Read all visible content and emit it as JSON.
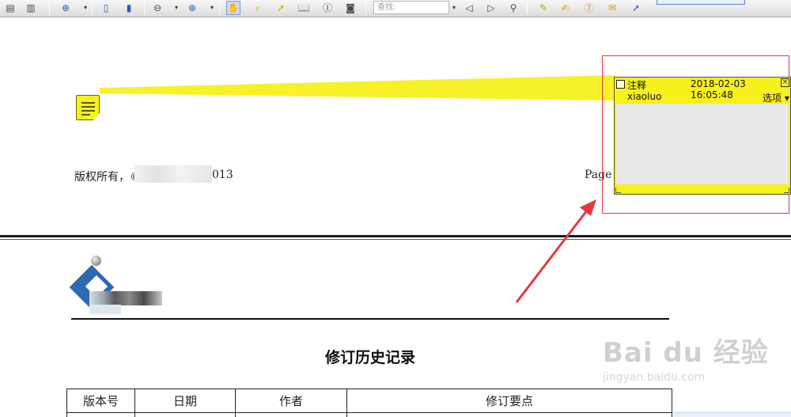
{
  "toolbar": {
    "search_placeholder": "查找:",
    "icons": [
      "page-up-icon",
      "page-down-icon",
      "zoom-in-icon",
      "dropdown-icon",
      "single-page-icon",
      "continuous-page-icon",
      "zoom-out-icon",
      "dropdown-icon",
      "zoom-plus-icon",
      "dropdown-icon",
      "hand-icon",
      "loupe-icon",
      "select-arrow-icon",
      "book-icon",
      "text-select-icon",
      "snapshot-icon",
      "find-prev-icon",
      "find-next-icon",
      "find-all-icon",
      "pencil-icon",
      "note-edit-icon",
      "typewriter-icon",
      "comment-icon",
      "arrow-tool-icon"
    ]
  },
  "page1": {
    "footer_left": "版权所有，©",
    "footer_year": "013",
    "footer_page": "Page"
  },
  "annotation": {
    "title": "注释",
    "datetime": "2018-02-03 16:05:48",
    "close": "×",
    "author": "xiaoluo",
    "options": "选项 ▾",
    "body_text": ""
  },
  "page2": {
    "doc_title": "修订历史记录",
    "table_headers": [
      "版本号",
      "日期",
      "作者",
      "修订要点"
    ]
  },
  "watermark": {
    "main": "Bai du 经验",
    "sub": "jingyan.baidu.com"
  },
  "colors": {
    "note_yellow": "#f7f01c",
    "annotation_frame": "#e8373a",
    "logo_blue": "#2f6ab0"
  }
}
